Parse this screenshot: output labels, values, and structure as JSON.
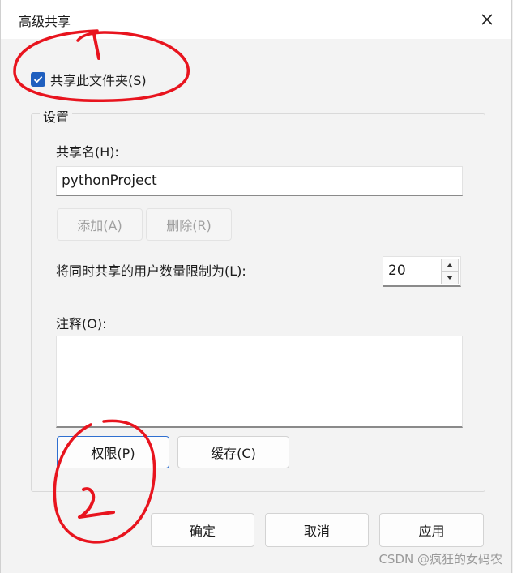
{
  "window": {
    "title": "高级共享"
  },
  "share_checkbox": {
    "label": "共享此文件夹(S)",
    "checked": true
  },
  "settings": {
    "group_label": "设置",
    "share_name_label": "共享名(H):",
    "share_name_value": "pythonProject",
    "add_button": "添加(A)",
    "remove_button": "删除(R)",
    "user_limit_label": "将同时共享的用户数量限制为(L):",
    "user_limit_value": "20",
    "comment_label": "注释(O):",
    "comment_value": "",
    "permissions_button": "权限(P)",
    "caching_button": "缓存(C)"
  },
  "footer": {
    "ok_button": "确定",
    "cancel_button": "取消",
    "apply_button": "应用"
  },
  "annotations": {
    "mark_1": "1",
    "mark_2": "2",
    "color": "#e8141e"
  },
  "watermark": "CSDN @疯狂的女码农",
  "colors": {
    "checkbox_accent": "#1f5fbf",
    "focus_border": "#2f6fd0"
  }
}
